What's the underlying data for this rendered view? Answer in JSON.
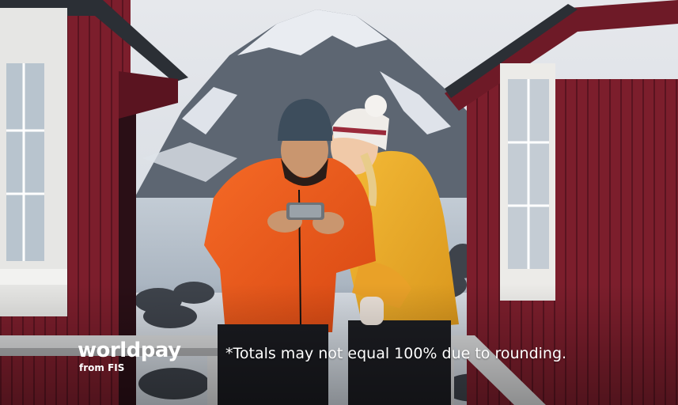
{
  "logo": {
    "word": "worldpay",
    "sub": "from FIS"
  },
  "footnote": "*Totals may not equal 100% due to rounding.",
  "photo": {
    "description_icons": [
      "mountain",
      "cabin",
      "couple",
      "smartphone"
    ]
  },
  "colors": {
    "cabin_red": "#7a1f2c",
    "jacket_orange": "#e8541c",
    "jacket_yellow": "#e8a526",
    "mountain_snow": "#dfe3ea",
    "water": "#b9c4cf"
  }
}
